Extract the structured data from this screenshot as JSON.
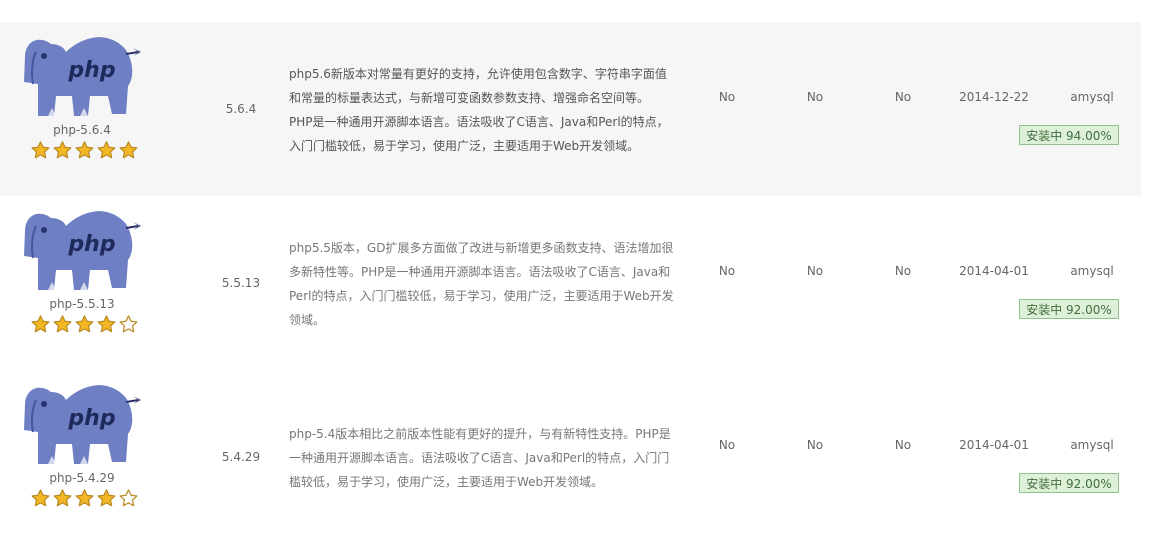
{
  "rows": [
    {
      "name": "php-5.6.4",
      "version": "5.6.4",
      "description": "php5.6新版本对常量有更好的支持，允许使用包含数字、字符串字面值和常量的标量表达式，与新增可变函数参数支持、增强命名空间等。PHP是一种通用开源脚本语言。语法吸收了C语言、Java和Perl的特点，入门门槛较低，易于学习，使用广泛，主要适用于Web开发领域。",
      "desc_lines": [
        "php5.6新版本对常量有更好的支持，允许使用包含数字、字符串字面值",
        "和常量的标量表达式，与新增可变函数参数支持、增强命名空间等。",
        "PHP是一种通用开源脚本语言。语法吸收了C语言、Java和Perl的特点，",
        "入门门槛较低，易于学习，使用广泛，主要适用于Web开发领域。"
      ],
      "col1": "No",
      "col2": "No",
      "col3": "No",
      "date": "2014-12-22",
      "user": "amysql",
      "status": "安装中 94.00%",
      "progress": 0.94,
      "rating": 5,
      "rating_max": 5
    },
    {
      "name": "php-5.5.13",
      "version": "5.5.13",
      "description": "php5.5版本，GD扩展多方面做了改进与新增更多函数支持、语法增加很多新特性等。PHP是一种通用开源脚本语言。语法吸收了C语言、Java和Perl的特点，入门门槛较低，易于学习，使用广泛，主要适用于Web开发领域。",
      "desc_lines": [
        "php5.5版本，GD扩展多方面做了改进与新增更多函数支持、语法增加很",
        "多新特性等。PHP是一种通用开源脚本语言。语法吸收了C语言、Java和",
        "Perl的特点，入门门槛较低，易于学习，使用广泛，主要适用于Web开发",
        "领域。"
      ],
      "col1": "No",
      "col2": "No",
      "col3": "No",
      "date": "2014-04-01",
      "user": "amysql",
      "status": "安装中 92.00%",
      "progress": 0.92,
      "rating": 4,
      "rating_max": 5
    },
    {
      "name": "php-5.4.29",
      "version": "5.4.29",
      "description": "php-5.4版本相比之前版本性能有更好的提升，与有新特性支持。PHP是一种通用开源脚本语言。语法吸收了C语言、Java和Perl的特点，入门门槛较低，易于学习，使用广泛，主要适用于Web开发领域。",
      "desc_lines": [
        "php-5.4版本相比之前版本性能有更好的提升，与有新特性支持。PHP是",
        "一种通用开源脚本语言。语法吸收了C语言、Java和Perl的特点，入门门",
        "槛较低，易于学习，使用广泛，主要适用于Web开发领域。"
      ],
      "col1": "No",
      "col2": "No",
      "col3": "No",
      "date": "2014-04-01",
      "user": "amysql",
      "status": "安装中 92.00%",
      "progress": 0.92,
      "rating": 4,
      "rating_max": 5
    }
  ],
  "logo_text": "php",
  "colors": {
    "row_alt_bg": "#f6f6f6",
    "badge_bg": "#dff0d8",
    "badge_border": "#8fc08f",
    "badge_text": "#3f6e3f",
    "elephant": "#6f7fc3",
    "star_fill": "#f3b625",
    "star_empty": "#ffffff",
    "star_stroke": "#b88a20"
  }
}
